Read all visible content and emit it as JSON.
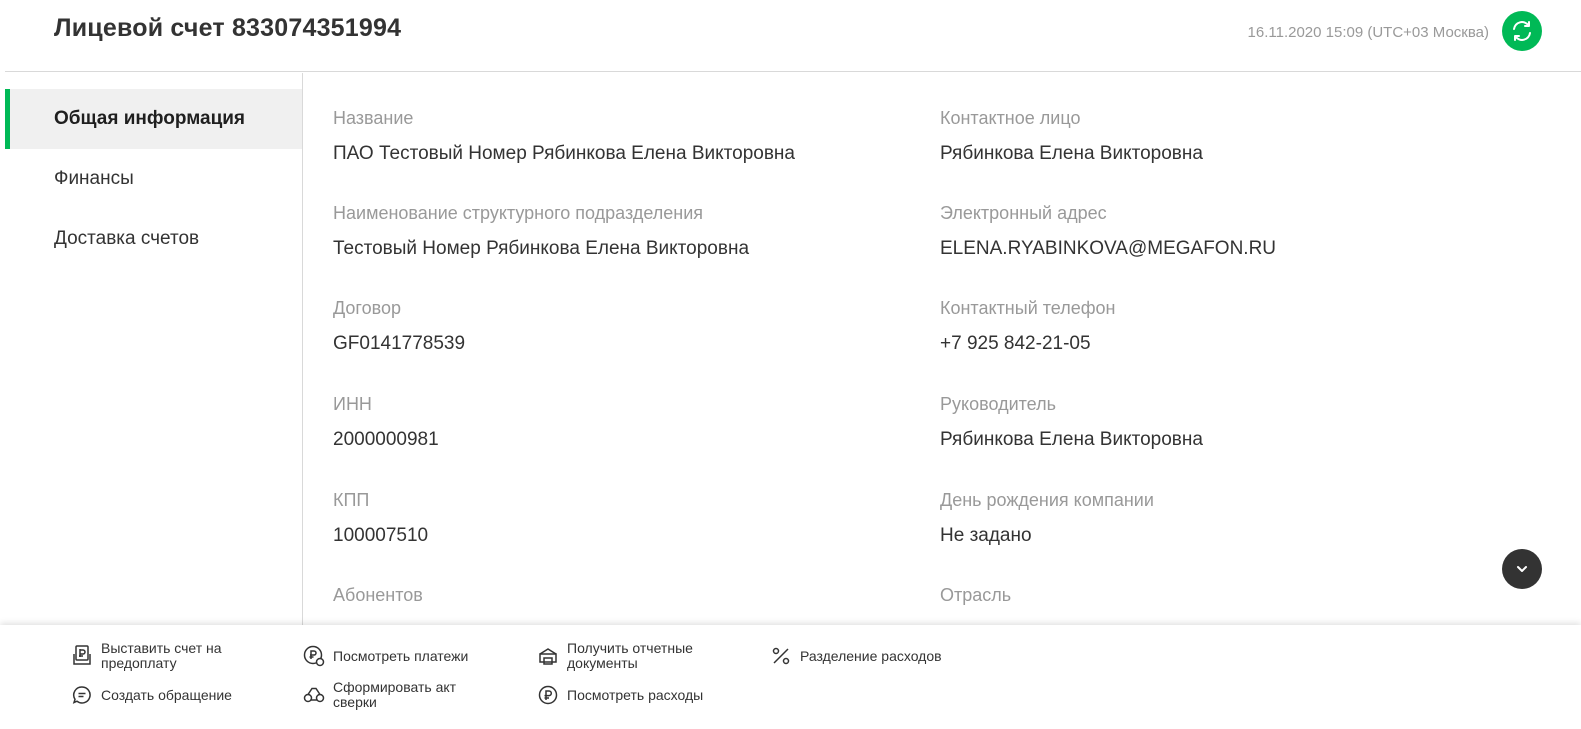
{
  "header": {
    "title": "Лицевой счет 833074351994",
    "timestamp": "16.11.2020 15:09 (UTC+03 Москва)"
  },
  "sidebar": {
    "items": [
      {
        "label": "Общая информация",
        "active": true
      },
      {
        "label": "Финансы",
        "active": false
      },
      {
        "label": "Доставка счетов",
        "active": false
      }
    ]
  },
  "info": {
    "left": [
      {
        "label": "Название",
        "value": "ПАО Тестовый Номер Рябинкова Елена Викторовна"
      },
      {
        "label": "Наименование структурного подразделения",
        "value": "Тестовый Номер Рябинкова Елена Викторовна"
      },
      {
        "label": "Договор",
        "value": "GF0141778539"
      },
      {
        "label": "ИНН",
        "value": "2000000981"
      },
      {
        "label": "КПП",
        "value": "100007510"
      },
      {
        "label": "Абонентов",
        "value": ""
      }
    ],
    "right": [
      {
        "label": "Контактное лицо",
        "value": "Рябинкова Елена Викторовна"
      },
      {
        "label": "Электронный адрес",
        "value": "ELENA.RYABINKOVA@MEGAFON.RU"
      },
      {
        "label": "Контактный телефон",
        "value": "+7 925 842-21-05"
      },
      {
        "label": "Руководитель",
        "value": "Рябинкова Елена Викторовна"
      },
      {
        "label": "День рождения компании",
        "value": "Не задано"
      },
      {
        "label": "Отрасль",
        "value": ""
      }
    ]
  },
  "actions": [
    {
      "label": "Выставить счет на предоплату",
      "icon": "invoice-icon"
    },
    {
      "label": "Посмотреть платежи",
      "icon": "ruble-clock-icon"
    },
    {
      "label": "Получить отчетные документы",
      "icon": "printer-icon"
    },
    {
      "label": "Разделение расходов",
      "icon": "percent-icon"
    },
    {
      "label": "Создать обращение",
      "icon": "chat-icon"
    },
    {
      "label": "Сформировать акт сверки",
      "icon": "scales-icon"
    },
    {
      "label": "Посмотреть расходы",
      "icon": "ruble-icon"
    }
  ],
  "colors": {
    "accent": "#00b956",
    "text": "#333333",
    "muted": "#999999"
  }
}
